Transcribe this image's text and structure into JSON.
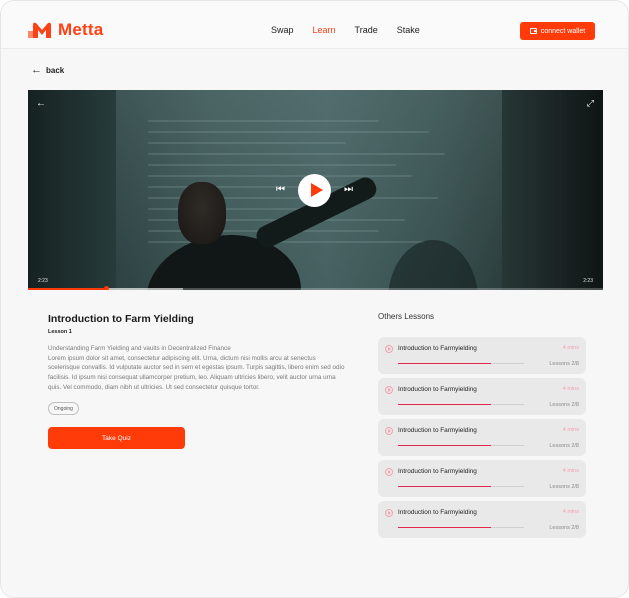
{
  "brand": {
    "name": "Metta",
    "accent": "#ff3b0a"
  },
  "nav": {
    "items": [
      "Swap",
      "Learn",
      "Trade",
      "Stake"
    ],
    "active": "Learn"
  },
  "header": {
    "connect_wallet": "connect wallet"
  },
  "back": {
    "label": "back"
  },
  "video": {
    "time_elapsed": "2:23",
    "time_total": "2:23",
    "progress": 0.135,
    "buffered": 0.27
  },
  "lesson": {
    "title": "Introduction to Farm Yielding",
    "number": "Lesson 1",
    "description": [
      "Understanding Farm Yielding and vaults in Decentralized Finance",
      "Lorem ipsum dolor sit amet, consectetur adipiscing elit. Urna, dictum nisi mollis arcu at senectus scelerisque convallis. Id vulputate auctor sed in sem et egestas ipsum. Turpis sagittis, libero enim sed odio facilisis. Id ipsum nisi consequat ullamcorper pretium, leo. Aliquam ultricies libero, velit auctor urna urna quis. Vel commodo, diam nibh ut ultricies. Ut sed consectetur quisque tortor."
    ],
    "status": "Ongoing",
    "take_quiz": "Take Quiz"
  },
  "others": {
    "title": "Others Lessons",
    "items": [
      {
        "title": "Introduction to Farmyielding",
        "duration": "4 mins",
        "lessons": "Lessons 2/8",
        "progress": 0.74
      },
      {
        "title": "Introduction to Farmyielding",
        "duration": "4 mins",
        "lessons": "Lessons 2/8",
        "progress": 0.74
      },
      {
        "title": "Introduction to Farmyielding",
        "duration": "4 mins",
        "lessons": "Lessons 2/8",
        "progress": 0.74
      },
      {
        "title": "Introduction to Farmyielding",
        "duration": "4 mins",
        "lessons": "Lessons 2/8",
        "progress": 0.74
      },
      {
        "title": "Introduction to Farmyielding",
        "duration": "4 mins",
        "lessons": "Lessons 2/8",
        "progress": 0.74
      }
    ]
  }
}
